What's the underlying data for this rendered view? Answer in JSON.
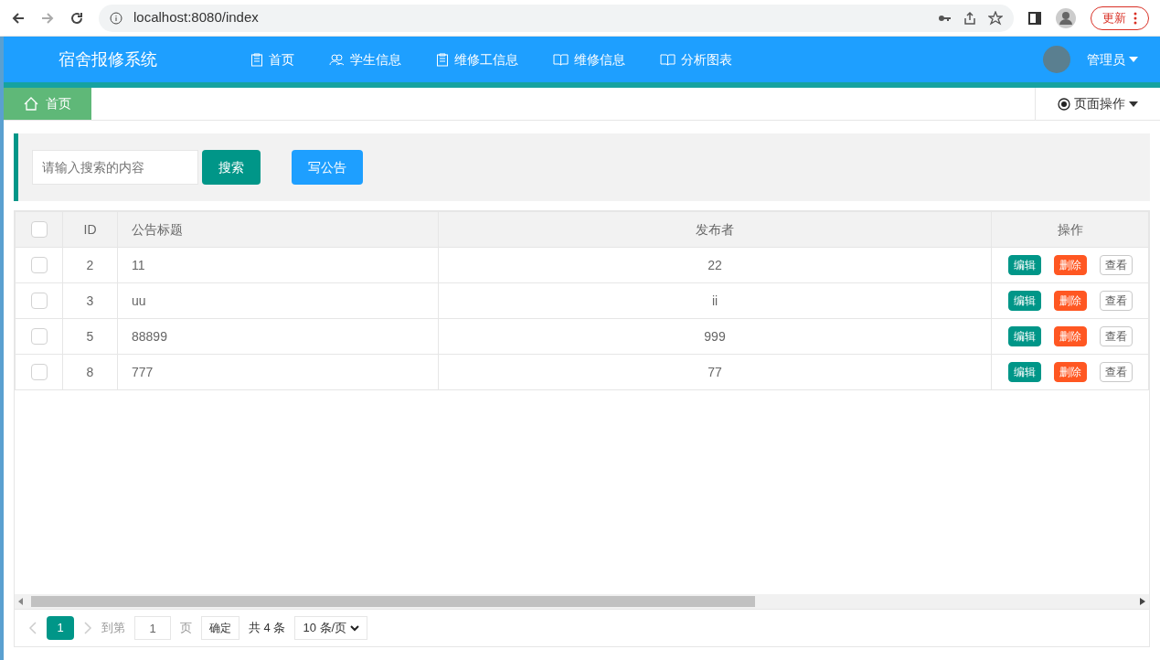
{
  "browser": {
    "url": "localhost:8080/index",
    "update_button": "更新"
  },
  "header": {
    "title": "宿舍报修系统",
    "nav": [
      {
        "label": "首页",
        "kind": "clipboard"
      },
      {
        "label": "学生信息",
        "kind": "users"
      },
      {
        "label": "维修工信息",
        "kind": "clipboard"
      },
      {
        "label": "维修信息",
        "kind": "book"
      },
      {
        "label": "分析图表",
        "kind": "book"
      }
    ],
    "user": "管理员"
  },
  "tabs": [
    {
      "label": "首页",
      "selected": true
    }
  ],
  "page_ops": "页面操作",
  "toolbar": {
    "search_placeholder": "请输入搜索的内容",
    "search_button": "搜索",
    "write_button": "写公告"
  },
  "table": {
    "columns": [
      "ID",
      "公告标题",
      "发布者",
      "操作"
    ],
    "all_checked": false,
    "rows": [
      {
        "checked": false,
        "id": "2",
        "title": "11",
        "publisher": "22",
        "actions": [
          "编辑",
          "删除",
          "查看"
        ]
      },
      {
        "checked": false,
        "id": "3",
        "title": "uu",
        "publisher": "ii",
        "actions": [
          "编辑",
          "删除",
          "查看"
        ]
      },
      {
        "checked": false,
        "id": "5",
        "title": "88899",
        "publisher": "999",
        "actions": [
          "编辑",
          "删除",
          "查看"
        ]
      },
      {
        "checked": false,
        "id": "8",
        "title": "777",
        "publisher": "77",
        "actions": [
          "编辑",
          "删除",
          "查看"
        ]
      }
    ]
  },
  "pager": {
    "pages": [
      {
        "label": "1",
        "selected": true
      }
    ],
    "goto_label": "到第",
    "goto_value": "1",
    "page_unit": "页",
    "confirm": "确定",
    "total": "共 4 条",
    "page_size": "10 条/页"
  }
}
